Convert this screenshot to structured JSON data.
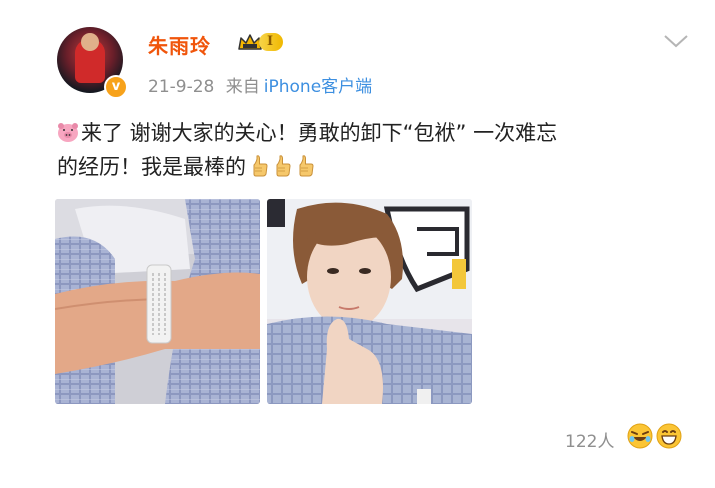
{
  "post": {
    "author": {
      "name": "朱雨玲",
      "vip_level": "I"
    },
    "meta": {
      "date": "21-9-28",
      "source_prefix": "来自",
      "device": "iPhone客户端"
    },
    "text": {
      "line1": "来了 谢谢大家的关心！勇敢的卸下“包袱” 一次难忘",
      "line2": "的经历！我是最棒的"
    },
    "images": [
      {
        "icon": "photo-wristband"
      },
      {
        "icon": "photo-selfie"
      }
    ],
    "reactions": {
      "count": "122人"
    }
  },
  "icons": {
    "avatar": "avatar",
    "verified": "verified-badge-icon",
    "vip": "crown-icon",
    "more": "chevron-down-icon",
    "pig": "pig-emoji-icon",
    "thumbs": "thumbs-up-icon",
    "reaction_laugh": "laugh-emoji-icon",
    "reaction_grin": "grin-emoji-icon"
  },
  "colors": {
    "username": "#f0550b",
    "meta": "#8f8f8f",
    "link": "#3d8fe0",
    "vip_badge": "#f0b800",
    "verified_badge": "#f7a21b"
  }
}
